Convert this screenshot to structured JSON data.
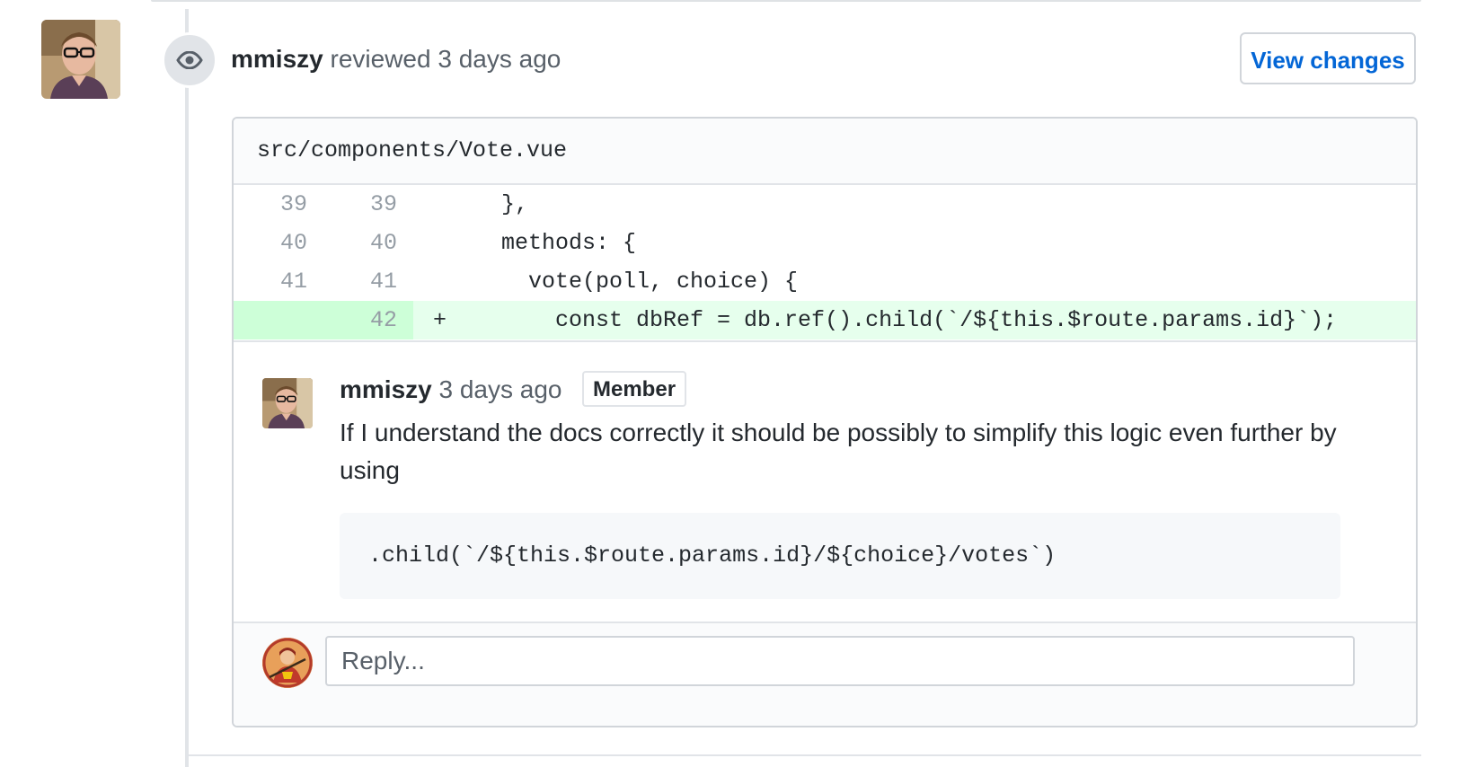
{
  "review": {
    "author": "mmiszy",
    "action": " reviewed ",
    "time": "3 days ago",
    "view_changes_label": "View changes",
    "icon": "eye-icon"
  },
  "file": {
    "path": "src/components/Vote.vue"
  },
  "diff": {
    "rows": [
      {
        "old": "39",
        "new": "39",
        "marker": "",
        "code": "  },",
        "added": false
      },
      {
        "old": "40",
        "new": "40",
        "marker": "",
        "code": "  methods: {",
        "added": false
      },
      {
        "old": "41",
        "new": "41",
        "marker": "",
        "code": "    vote(poll, choice) {",
        "added": false
      },
      {
        "old": "",
        "new": "42",
        "marker": "+",
        "code": "      const dbRef = db.ref().child(`/${this.$route.params.id}`);",
        "added": true
      }
    ]
  },
  "comment": {
    "author": "mmiszy",
    "time": "3 days ago",
    "badge": "Member",
    "body": "If I understand the docs correctly it should be possibly to simplify this logic even further by using",
    "code": ".child(`/${this.$route.params.id}/${choice}/votes`)"
  },
  "reply": {
    "placeholder": "Reply..."
  },
  "colors": {
    "link": "#0366d6",
    "added_bg": "#e6ffed",
    "added_gutter": "#cdffd8",
    "border": "#d1d5da"
  }
}
